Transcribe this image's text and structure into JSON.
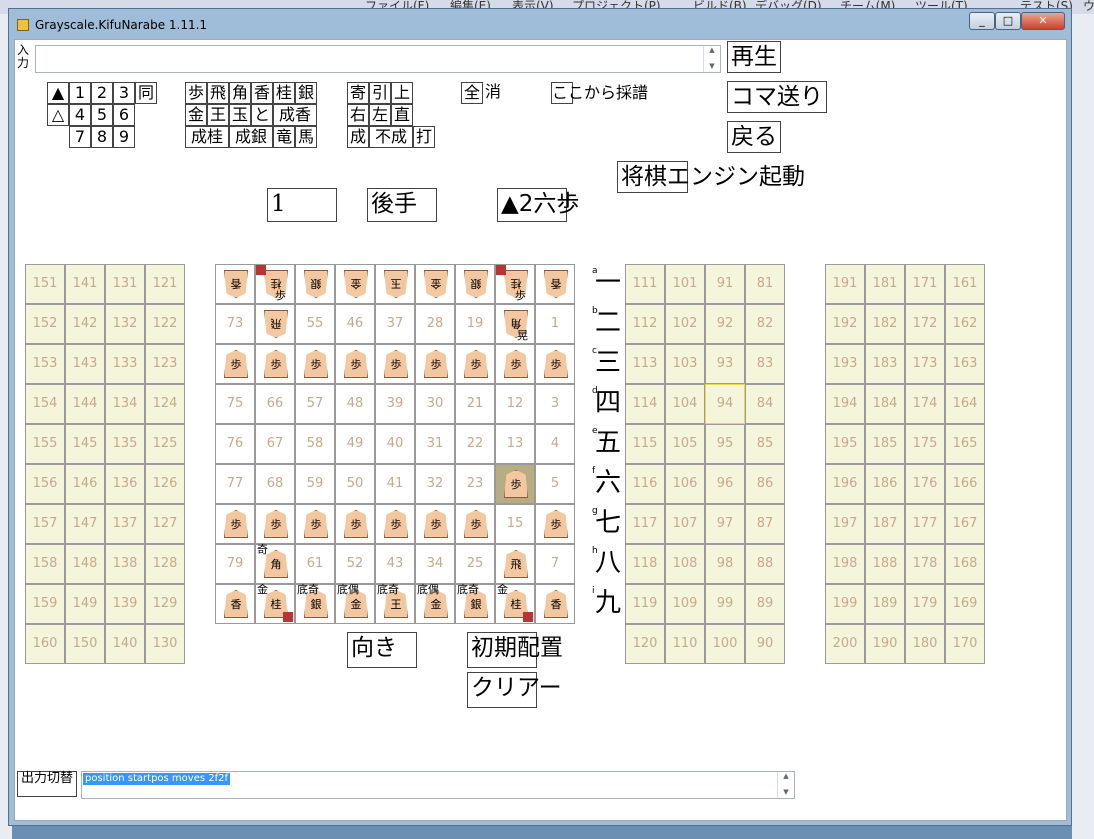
{
  "ide": {
    "menu": [
      "ファイル(F)",
      "編集(E)",
      "表示(V)",
      "プロジェクト(P)",
      "ビルド(B)",
      "デバッグ(D)",
      "チーム(M)",
      "ツール(T)",
      "テスト(S)",
      "ウィ"
    ]
  },
  "window": {
    "title": "Grayscale.KifuNarabe 1.11.1",
    "controls": [
      "_",
      "□",
      "✕"
    ]
  },
  "input": {
    "label": "入力",
    "value": ""
  },
  "buttons": {
    "play": "再生",
    "step": "コマ送り",
    "back": "戻る",
    "engine": "将棋エンジン起動",
    "move_count": "1",
    "turn": "後手",
    "last_move": "▲2六歩",
    "orientation": "向き",
    "initial": "初期配置",
    "clear": "クリアー",
    "output_switch": "出力切替"
  },
  "keypad": {
    "row1": [
      "▲",
      "1",
      "2",
      "3",
      "同"
    ],
    "row2": [
      "△",
      "4",
      "5",
      "6"
    ],
    "row3": [
      "7",
      "8",
      "9"
    ],
    "pieces_row1": [
      "歩",
      "飛",
      "角",
      "香",
      "桂",
      "銀"
    ],
    "pieces_row2": [
      "金",
      "王",
      "玉",
      "と",
      "成香"
    ],
    "pieces_row3": [
      "成桂",
      "成銀",
      "竜",
      "馬"
    ],
    "mods_row1": [
      "寄",
      "引",
      "上"
    ],
    "mods_row2": [
      "右",
      "左",
      "直"
    ],
    "mods_row3": [
      "成",
      "不成",
      "打"
    ],
    "all_clear": "全",
    "all_clear_suffix": "消",
    "record_from": "ここから採譜"
  },
  "board": {
    "files": [
      "9",
      "8",
      "7",
      "6",
      "5",
      "4",
      "3",
      "2",
      "1"
    ],
    "ranks": [
      "一",
      "二",
      "三",
      "四",
      "五",
      "六",
      "七",
      "八",
      "九"
    ],
    "rank_letters": [
      "a",
      "b",
      "c",
      "d",
      "e",
      "f",
      "g",
      "h",
      "i"
    ],
    "cells": [
      [
        "香",
        "桂",
        "銀",
        "金",
        "玉",
        "金",
        "銀",
        "桂",
        "香"
      ],
      [
        "73",
        "飛",
        "55",
        "46",
        "37",
        "28",
        "19",
        "角",
        "1"
      ],
      [
        "歩",
        "歩",
        "歩",
        "歩",
        "歩",
        "歩",
        "歩",
        "歩",
        "歩"
      ],
      [
        "75",
        "66",
        "57",
        "48",
        "39",
        "30",
        "21",
        "12",
        "3"
      ],
      [
        "76",
        "67",
        "58",
        "49",
        "40",
        "31",
        "22",
        "13",
        "4"
      ],
      [
        "77",
        "68",
        "59",
        "50",
        "41",
        "32",
        "23",
        "歩",
        "5"
      ],
      [
        "歩",
        "歩",
        "歩",
        "歩",
        "歩",
        "歩",
        "歩",
        "15",
        "歩"
      ],
      [
        "79",
        "角",
        "61",
        "52",
        "43",
        "34",
        "25",
        "飛",
        "7"
      ],
      [
        "香",
        "桂",
        "銀",
        "金",
        "王",
        "金",
        "銀",
        "桂",
        "香"
      ]
    ],
    "top_tags": [
      "",
      "歩",
      "",
      "",
      "",
      "",
      "",
      "歩",
      ""
    ],
    "tags_row1": [
      "",
      "",
      "",
      "",
      "",
      "",
      "",
      "晃",
      ""
    ],
    "tags_row7": [
      "",
      "奇",
      "",
      "",
      "",
      "",
      "",
      "",
      ""
    ],
    "tags_row8": [
      "",
      "金",
      "底奇",
      "底偶",
      "底奇",
      "底偶",
      "底奇",
      "金",
      ""
    ]
  },
  "hand_left": {
    "rows": [
      [
        "151",
        "141",
        "131",
        "121"
      ],
      [
        "152",
        "142",
        "132",
        "122"
      ],
      [
        "153",
        "143",
        "133",
        "123"
      ],
      [
        "154",
        "144",
        "134",
        "124"
      ],
      [
        "155",
        "145",
        "135",
        "125"
      ],
      [
        "156",
        "146",
        "136",
        "126"
      ],
      [
        "157",
        "147",
        "137",
        "127"
      ],
      [
        "158",
        "148",
        "138",
        "128"
      ],
      [
        "159",
        "149",
        "139",
        "129"
      ],
      [
        "160",
        "150",
        "140",
        "130"
      ]
    ]
  },
  "hand_right": {
    "rows": [
      [
        "111",
        "101",
        "91",
        "81"
      ],
      [
        "112",
        "102",
        "92",
        "82"
      ],
      [
        "113",
        "103",
        "93",
        "83"
      ],
      [
        "114",
        "104",
        "94",
        "84"
      ],
      [
        "115",
        "105",
        "95",
        "85"
      ],
      [
        "116",
        "106",
        "96",
        "86"
      ],
      [
        "117",
        "107",
        "97",
        "87"
      ],
      [
        "118",
        "108",
        "98",
        "88"
      ],
      [
        "119",
        "109",
        "99",
        "89"
      ],
      [
        "120",
        "110",
        "100",
        "90"
      ]
    ]
  },
  "hand_far": {
    "rows": [
      [
        "191",
        "181",
        "171",
        "161"
      ],
      [
        "192",
        "182",
        "172",
        "162"
      ],
      [
        "193",
        "183",
        "173",
        "163"
      ],
      [
        "194",
        "184",
        "174",
        "164"
      ],
      [
        "195",
        "185",
        "175",
        "165"
      ],
      [
        "196",
        "186",
        "176",
        "166"
      ],
      [
        "197",
        "187",
        "177",
        "167"
      ],
      [
        "198",
        "188",
        "178",
        "168"
      ],
      [
        "199",
        "189",
        "179",
        "169"
      ],
      [
        "200",
        "190",
        "180",
        "170"
      ]
    ]
  },
  "output": {
    "value": "position startpos moves 2f2f"
  },
  "colors": {
    "board_sub": "#f5f5dc",
    "piece": "#f3c79f",
    "highlight": "#e8d84a",
    "selection": "#3399ff"
  }
}
